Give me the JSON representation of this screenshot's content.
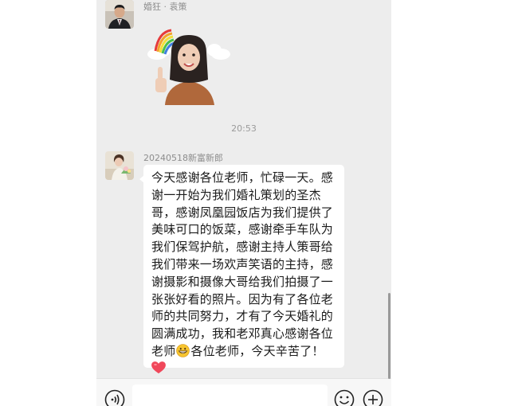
{
  "messages": {
    "first": {
      "sender_name": "婚狂 · 袁策",
      "sticker": "rainbow-thumbs-up-sticker"
    },
    "timestamp": "20:53",
    "second": {
      "sender_name": "20240518新富新郎",
      "text": "今天感谢各位老师，忙碌一天。感谢一开始为我们婚礼策划的圣杰哥，感谢凤凰园饭店为我们提供了美味可口的饭菜，感谢牵手车队为我们保驾护航，感谢主持人策哥给我们带来一场欢声笑语的主持，感谢摄影和摄像大哥给我们拍摄了一张张好看的照片。因为有了各位老师的共同努力，才有了今天婚礼的圆满成功，我和老邓真心感谢各位老师",
      "text_after_emoji": "各位老师，今天辛苦了！",
      "inline_emoji": "grinning-face",
      "trailing_emoji": "red-heart"
    }
  },
  "toolbar": {
    "voice_icon": "voice-icon",
    "emoji_icon": "emoji-icon",
    "plus_icon": "plus-icon"
  },
  "colors": {
    "background": "#ededed",
    "bubble": "#ffffff",
    "heart": "#f0475a"
  }
}
